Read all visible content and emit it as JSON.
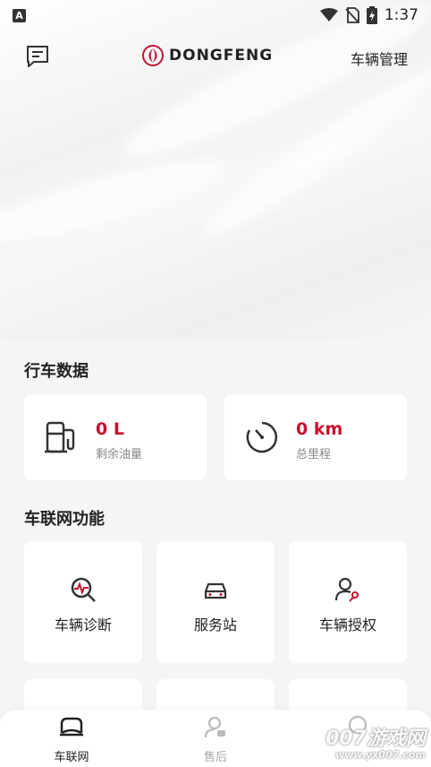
{
  "status_bar": {
    "time": "1:37",
    "sim_label": "A"
  },
  "header": {
    "brand": "DONGFENG",
    "manage_label": "车辆管理"
  },
  "driving_data": {
    "title": "行车数据",
    "fuel": {
      "value": "0 L",
      "label": "剩余油量"
    },
    "mileage": {
      "value": "0 km",
      "label": "总里程"
    }
  },
  "iov": {
    "title": "车联网功能",
    "items": [
      {
        "label": "车辆诊断",
        "icon": "diagnosis-icon"
      },
      {
        "label": "服务站",
        "icon": "car-service-icon"
      },
      {
        "label": "车辆授权",
        "icon": "user-key-icon"
      }
    ]
  },
  "tabbar": {
    "tabs": [
      {
        "label": "车联网",
        "icon": "car-icon",
        "active": true
      },
      {
        "label": "售后",
        "icon": "after-sales-icon",
        "active": false
      },
      {
        "label": "",
        "icon": "mine-icon",
        "active": false
      }
    ]
  },
  "watermark": {
    "line1": "007游戏网",
    "line2": "www.yx007.com"
  },
  "colors": {
    "accent": "#c8102e",
    "background": "#f5f5f5",
    "card": "#ffffff"
  }
}
